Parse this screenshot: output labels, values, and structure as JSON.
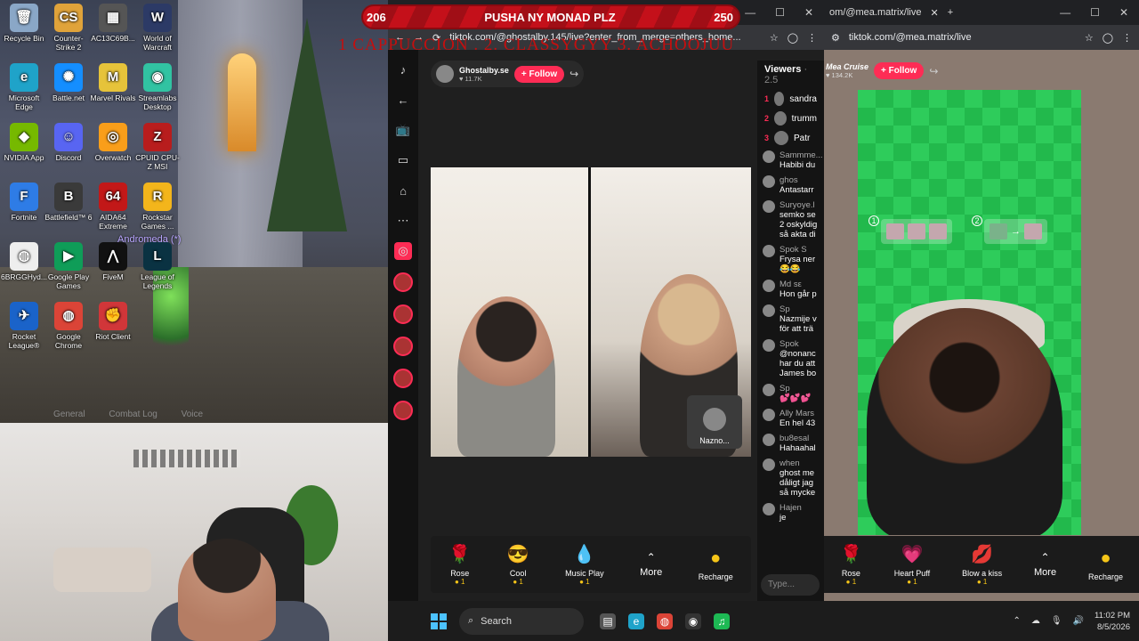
{
  "banner": {
    "left_count": "206",
    "text": "PUSHA NY MONAD PLZ",
    "right_count": "250",
    "subtitle": "1 CAPPUCCION . 2. CLASSYGYY 3. ACHOOJUU"
  },
  "desktop": {
    "icons": [
      {
        "label": "Recycle Bin",
        "icon": "recycle-bin-icon",
        "color": "#8aa7c7",
        "glyph": "🗑"
      },
      {
        "label": "Counter-Strike 2",
        "icon": "counter-strike-icon",
        "color": "#e0a33a",
        "glyph": "CS"
      },
      {
        "label": "AC13C69B...",
        "icon": "file-icon",
        "color": "#555",
        "glyph": "▦"
      },
      {
        "label": "World of Warcraft",
        "icon": "wow-icon",
        "color": "#2c3a66",
        "glyph": "W"
      },
      {
        "label": "Microsoft Edge",
        "icon": "edge-icon",
        "color": "#1fa3c9",
        "glyph": "e"
      },
      {
        "label": "Battle.net",
        "icon": "battlenet-icon",
        "color": "#148eff",
        "glyph": "✺"
      },
      {
        "label": "Marvel Rivals",
        "icon": "marvel-rivals-icon",
        "color": "#e6c33a",
        "glyph": "M"
      },
      {
        "label": "Streamlabs Desktop",
        "icon": "streamlabs-icon",
        "color": "#31c3a2",
        "glyph": "◉"
      },
      {
        "label": "NVIDIA App",
        "icon": "nvidia-icon",
        "color": "#76b900",
        "glyph": "◆"
      },
      {
        "label": "Discord",
        "icon": "discord-icon",
        "color": "#5865f2",
        "glyph": "☺"
      },
      {
        "label": "Overwatch",
        "icon": "overwatch-icon",
        "color": "#f99e1a",
        "glyph": "◎"
      },
      {
        "label": "CPUID CPU-Z MSI",
        "icon": "cpuz-icon",
        "color": "#b81d1d",
        "glyph": "Z"
      },
      {
        "label": "Fortnite",
        "icon": "fortnite-icon",
        "color": "#2e7ce6",
        "glyph": "F"
      },
      {
        "label": "Battlefield™ 6",
        "icon": "battlefield-icon",
        "color": "#3a3a3a",
        "glyph": "B"
      },
      {
        "label": "AIDA64 Extreme",
        "icon": "aida64-icon",
        "color": "#c21818",
        "glyph": "64"
      },
      {
        "label": "Rockstar Games ...",
        "icon": "rockstar-icon",
        "color": "#f3b51b",
        "glyph": "R"
      },
      {
        "label": "6BRGGHyd...",
        "icon": "chrome-shortcut-icon",
        "color": "#eee",
        "glyph": "◍"
      },
      {
        "label": "Google Play Games",
        "icon": "google-play-icon",
        "color": "#0f9d58",
        "glyph": "▶"
      },
      {
        "label": "FiveM",
        "icon": "fivem-icon",
        "color": "#111",
        "glyph": "⋀"
      },
      {
        "label": "League of Legends",
        "icon": "league-icon",
        "color": "#0a3242",
        "glyph": "L"
      },
      {
        "label": "Rocket League®",
        "icon": "rocket-league-icon",
        "color": "#1a63c9",
        "glyph": "✈"
      },
      {
        "label": "Google Chrome",
        "icon": "chrome-icon",
        "color": "#db4437",
        "glyph": "◍"
      },
      {
        "label": "Riot Client",
        "icon": "riot-icon",
        "color": "#d13639",
        "glyph": "✊"
      }
    ],
    "game_tag": "Andromeda (*)",
    "game_bottom_tabs": [
      "General",
      "Combat Log",
      "Voice"
    ]
  },
  "browser_left": {
    "url": "tiktok.com/@ghostalby.145/live?enter_from_merge=others_home...",
    "streamer_name": "Ghostalby.se",
    "likes": "11.7K",
    "follow_label": "+ Follow",
    "pip_name": "Nazno...",
    "viewers_label": "Viewers",
    "viewers_count": "· 2.5",
    "top_viewers": [
      {
        "rank": "1",
        "name": "sandra"
      },
      {
        "rank": "2",
        "name": "trumm"
      },
      {
        "rank": "3",
        "name": "Patr"
      }
    ],
    "chat": [
      {
        "name": "Sammme...",
        "text": "Habibi du"
      },
      {
        "name": "ghos",
        "text": "Antastarr"
      },
      {
        "name": "Suryoye.l",
        "text": "semko se 2 oskyldig så akta di"
      },
      {
        "name": "Spok S",
        "text": "Frysa ner 😂😂"
      },
      {
        "name": "Md sε",
        "text": "Hon går p"
      },
      {
        "name": "Sp",
        "text": "Nazmije v för att trä"
      },
      {
        "name": "Spok",
        "text": "@nonanc har du att James bo"
      },
      {
        "name": "Sp",
        "text": "💕💕💕"
      },
      {
        "name": "Ally Mars",
        "text": "En hel 43"
      },
      {
        "name": "bu8esal",
        "text": "Hahaahal"
      },
      {
        "name": "when",
        "text": "ghost me dåligt jag så mycke"
      },
      {
        "name": "Hajen",
        "text": "je"
      }
    ],
    "type_placeholder": "Type...",
    "gifts": [
      {
        "name": "Rose",
        "price": "1",
        "glyph": "🌹"
      },
      {
        "name": "Cool",
        "price": "1",
        "glyph": "😎"
      },
      {
        "name": "Music Play",
        "price": "1",
        "glyph": "💧"
      }
    ],
    "more_label": "More",
    "recharge_label": "Recharge"
  },
  "browser_right": {
    "url": "tiktok.com/@mea.matrix/live",
    "tab_url": "om/@mea.matrix/live",
    "streamer_name": "Mea Cruise",
    "likes": "134.2K",
    "follow_label": "+ Follow",
    "steps": [
      "1",
      "2"
    ],
    "gifts": [
      {
        "name": "Rose",
        "price": "1",
        "glyph": "🌹"
      },
      {
        "name": "Heart Puff",
        "price": "1",
        "glyph": "💗"
      },
      {
        "name": "Blow a kiss",
        "price": "1",
        "glyph": "💋"
      }
    ],
    "more_label": "More",
    "recharge_label": "Recharge"
  },
  "taskbar": {
    "search_label": "Search",
    "time": "11:02 PM",
    "date": "8/5/2026"
  }
}
